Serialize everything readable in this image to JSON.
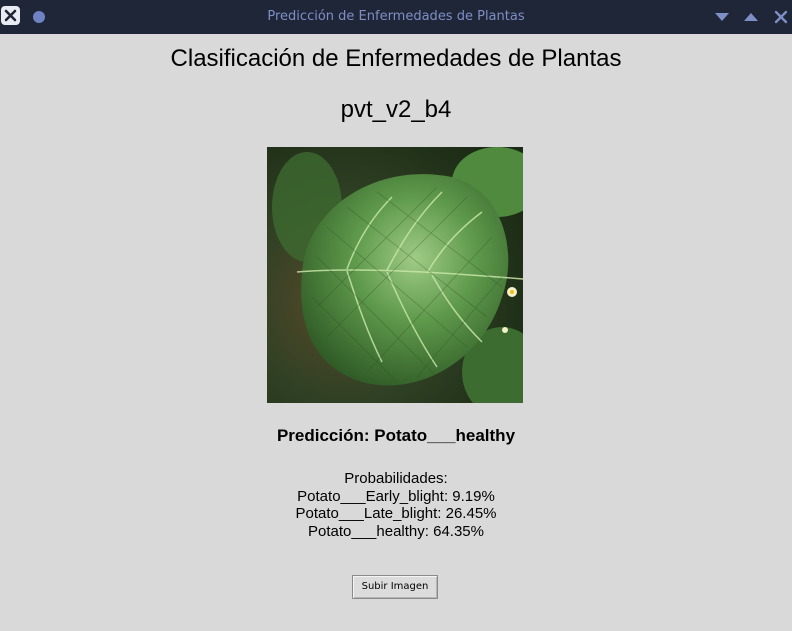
{
  "window": {
    "title": "Predicción de Enfermedades de Plantas",
    "titlebar_color": "#1f2638",
    "title_color": "#7e8fc6",
    "controls": [
      "close-icon",
      "dot-icon",
      "minimize-icon",
      "maximize-icon",
      "window-close-icon"
    ]
  },
  "main": {
    "app_title": "Clasificación de Enfermedades de Plantas",
    "model_name": "pvt_v2_b4",
    "image": {
      "description_icon": "leaf-image"
    },
    "prediction_text": "Predicción: Potato___healthy",
    "probabilities": {
      "header": "Probabilidades:",
      "items": [
        "Potato___Early_blight: 9.19%",
        "Potato___Late_blight: 26.45%",
        "Potato___healthy: 64.35%"
      ]
    },
    "upload_button_label": "Subir Imagen"
  },
  "colors": {
    "background": "#d9d9d9",
    "text": "#000000"
  }
}
